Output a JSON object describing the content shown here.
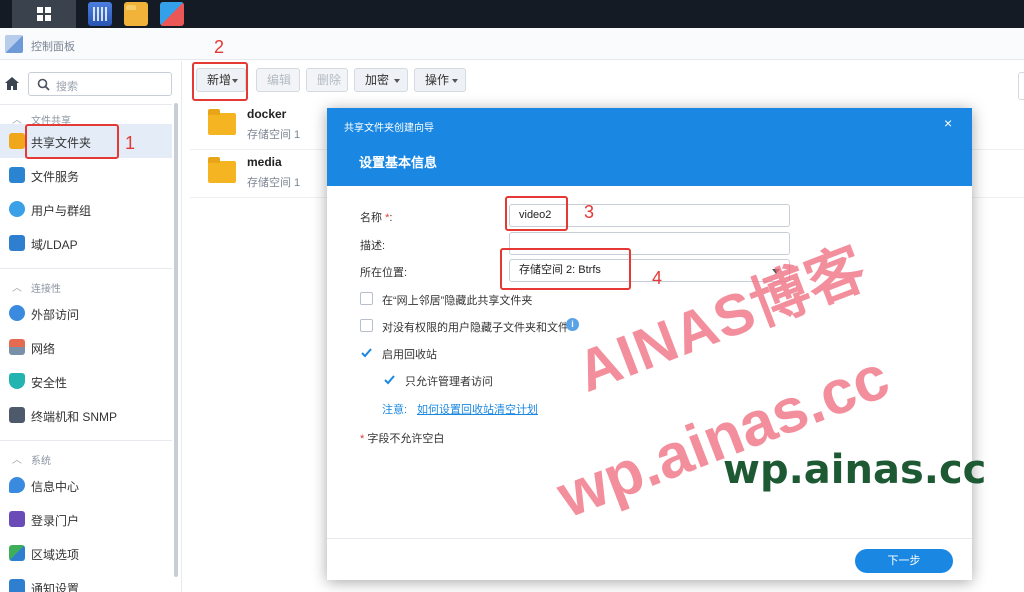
{
  "window": {
    "title": "控制面板"
  },
  "sidebar": {
    "search_placeholder": "搜索",
    "sections": [
      {
        "label": "文件共享",
        "items": [
          {
            "label": "共享文件夹",
            "icon": "shared-folder-icon",
            "active": true
          },
          {
            "label": "文件服务",
            "icon": "file-services-icon"
          },
          {
            "label": "用户与群组",
            "icon": "users-groups-icon"
          },
          {
            "label": "域/LDAP",
            "icon": "domain-ldap-icon"
          }
        ]
      },
      {
        "label": "连接性",
        "items": [
          {
            "label": "外部访问",
            "icon": "external-access-icon"
          },
          {
            "label": "网络",
            "icon": "network-icon"
          },
          {
            "label": "安全性",
            "icon": "security-shield-icon"
          },
          {
            "label": "终端机和 SNMP",
            "icon": "terminal-icon"
          }
        ]
      },
      {
        "label": "系统",
        "items": [
          {
            "label": "信息中心",
            "icon": "info-center-icon"
          },
          {
            "label": "登录门户",
            "icon": "login-portal-icon"
          },
          {
            "label": "区域选项",
            "icon": "regional-options-icon"
          },
          {
            "label": "通知设置",
            "icon": "notification-icon"
          }
        ]
      }
    ]
  },
  "toolbar": {
    "create": "新增",
    "edit": "编辑",
    "delete": "删除",
    "encrypt": "加密",
    "action": "操作"
  },
  "files": [
    {
      "name": "docker",
      "sub": "存储空间 1"
    },
    {
      "name": "media",
      "sub": "存储空间 1"
    }
  ],
  "dialog": {
    "wizard_title": "共享文件夹创建向导",
    "step_title": "设置基本信息",
    "close": "×",
    "name_label": "名称",
    "name_req": "*",
    "name_colon": ":",
    "name_value": "video2",
    "desc_label": "描述:",
    "desc_value": "",
    "location_label": "所在位置:",
    "location_value": "存储空间 2:  Btrfs",
    "opt_hide_network": {
      "label": "在“网上邻居”隐藏此共享文件夹",
      "checked": false
    },
    "opt_hide_subfolders": {
      "label": "对没有权限的用户隐藏子文件夹和文件",
      "checked": false
    },
    "opt_recycle_bin": {
      "label": "启用回收站",
      "checked": true
    },
    "opt_admin_only": {
      "label": "只允许管理者访问",
      "checked": true
    },
    "note_label": "注意:",
    "note_link": "如何设置回收站清空计划",
    "required_note": "字段不允许空白",
    "next_button": "下一步"
  },
  "annotations": {
    "n1": "1",
    "n2": "2",
    "n3": "3",
    "n4": "4"
  },
  "watermarks": {
    "w1": "AINAS博客",
    "w2": "wp.ainas.cc",
    "w3": "wp.ainas.cc"
  },
  "colors": {
    "accent": "#1a88e3",
    "annotation": "#e53935",
    "watermark": "#f06e82"
  }
}
